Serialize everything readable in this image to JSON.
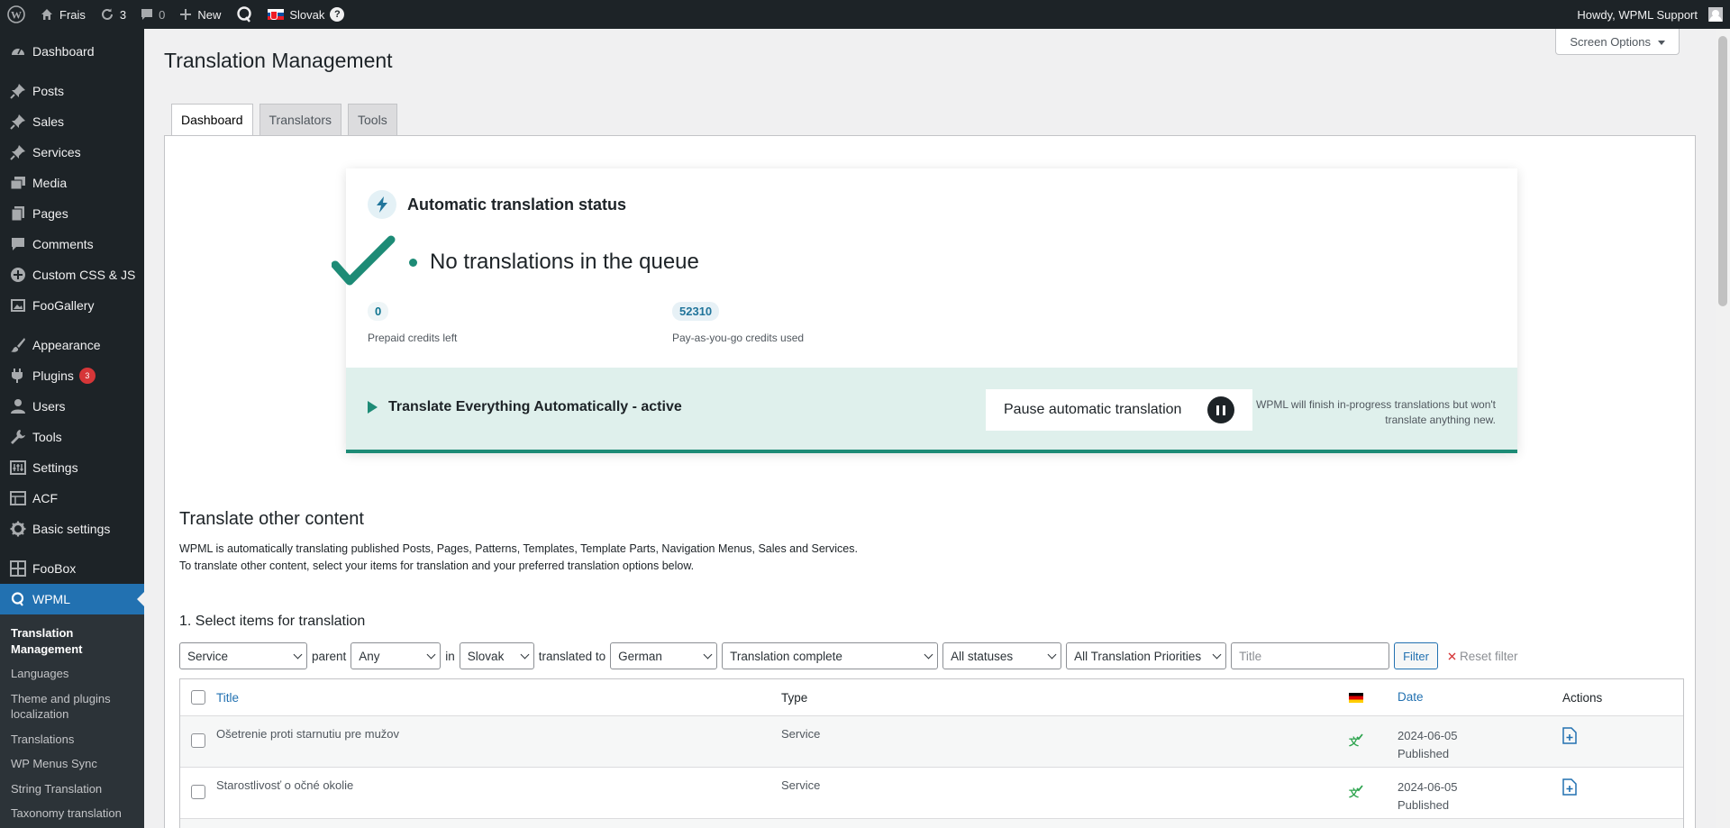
{
  "admin_bar": {
    "site_name": "Frais",
    "updates_count": "3",
    "comments_count": "0",
    "new_label": "New",
    "language": "Slovak",
    "help_glyph": "?",
    "howdy": "Howdy, WPML Support"
  },
  "sidebar": {
    "items": [
      {
        "label": "Dashboard",
        "icon": "dashboard-icon"
      },
      {
        "label": "Posts",
        "icon": "pin-icon"
      },
      {
        "label": "Sales",
        "icon": "pin-icon"
      },
      {
        "label": "Services",
        "icon": "pin-icon"
      },
      {
        "label": "Media",
        "icon": "media-icon"
      },
      {
        "label": "Pages",
        "icon": "pages-icon"
      },
      {
        "label": "Comments",
        "icon": "comment-icon"
      },
      {
        "label": "Custom CSS & JS",
        "icon": "plus-circle-icon"
      },
      {
        "label": "FooGallery",
        "icon": "gallery-icon"
      },
      {
        "label": "Appearance",
        "icon": "brush-icon"
      },
      {
        "label": "Plugins",
        "icon": "plugin-icon",
        "badge": "3"
      },
      {
        "label": "Users",
        "icon": "user-icon"
      },
      {
        "label": "Tools",
        "icon": "wrench-icon"
      },
      {
        "label": "Settings",
        "icon": "settings-icon"
      },
      {
        "label": "ACF",
        "icon": "acf-icon"
      },
      {
        "label": "Basic settings",
        "icon": "gear-icon"
      },
      {
        "label": "FooBox",
        "icon": "grid-icon"
      },
      {
        "label": "WPML",
        "icon": "wpml-icon"
      }
    ],
    "submenu": [
      "Translation Management",
      "Languages",
      "Theme and plugins localization",
      "Translations",
      "WP Menus Sync",
      "String Translation",
      "Taxonomy translation"
    ]
  },
  "screen_options": "Screen Options",
  "page_title": "Translation Management",
  "tabs": [
    "Dashboard",
    "Translators",
    "Tools"
  ],
  "status_card": {
    "title": "Automatic translation status",
    "queue_text": "No translations in the queue",
    "prepaid_value": "0",
    "prepaid_label": "Prepaid credits left",
    "payg_value": "52310",
    "payg_label": "Pay-as-you-go credits used",
    "mode_label": "Translate Everything Automatically - active",
    "pause_label": "Pause automatic translation",
    "note": "WPML will finish in-progress translations but won't translate anything new.",
    "accent_color": "#1d8b76"
  },
  "other": {
    "title": "Translate other content",
    "desc_line1": "WPML is automatically translating published Posts, Pages, Patterns, Templates, Template Parts, Navigation Menus, Sales and Services.",
    "desc_line2": "To translate other content, select your items for translation and your preferred translation options below.",
    "select_title": "1. Select items for translation"
  },
  "filters": {
    "type": "Service",
    "parent_label": "parent",
    "parent": "Any",
    "in_label": "in",
    "lang_from": "Slovak",
    "translated_to_label": "translated to",
    "lang_to": "German",
    "translation_status": "Translation complete",
    "status": "All statuses",
    "priority": "All Translation Priorities",
    "title_placeholder": "Title",
    "filter_button": "Filter",
    "reset_label": "Reset filter"
  },
  "table": {
    "headers": {
      "title": "Title",
      "type": "Type",
      "date": "Date",
      "actions": "Actions"
    },
    "rows": [
      {
        "title": "Ošetrenie proti starnutiu pre mužov",
        "type": "Service",
        "date": "2024-06-05",
        "status": "Published"
      },
      {
        "title": "Starostlivosť o očné okolie",
        "type": "Service",
        "date": "2024-06-05",
        "status": "Published"
      }
    ]
  }
}
